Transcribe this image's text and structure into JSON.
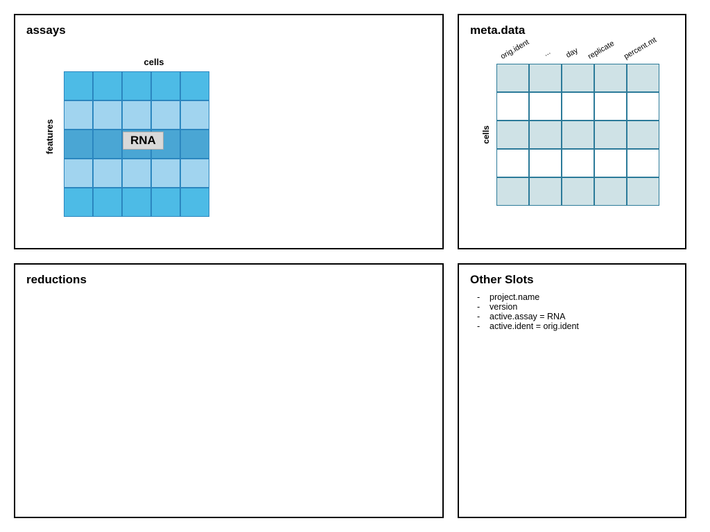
{
  "panels": {
    "assays": {
      "title": "assays",
      "top_label": "cells",
      "left_label": "features",
      "tag": "RNA",
      "grid": {
        "rows": 5,
        "cols": 5
      }
    },
    "metadata": {
      "title": "meta.data",
      "left_label": "cells",
      "columns": [
        "orig.ident",
        "...",
        "day",
        "replicate",
        "percent.mt"
      ],
      "grid": {
        "rows": 5,
        "cols": 5
      }
    },
    "reductions": {
      "title": "reductions"
    },
    "other_slots": {
      "title": "Other Slots",
      "items": [
        "project.name",
        "version",
        "active.assay = RNA",
        "active.ident = orig.ident"
      ]
    }
  }
}
